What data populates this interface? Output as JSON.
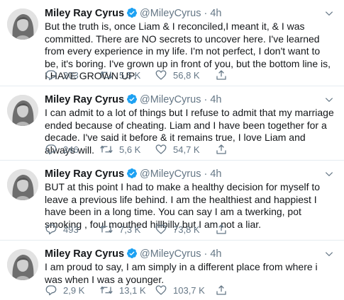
{
  "tweets": [
    {
      "name": "Miley Ray Cyrus",
      "handle": "@MileyCyrus",
      "dot": "·",
      "time": "4h",
      "text": "But the truth is, once Liam & I reconciled,I meant it, & I was committed. There are NO secrets to uncover here. I've learned from every experience in my life. I'm not perfect, I don't want to be, it's boring. I've grown up in front of you, but the bottom line is, I HAVE GROWN UP.",
      "replies": "203",
      "retweets": "5,5 K",
      "likes": "56,8 K"
    },
    {
      "name": "Miley Ray Cyrus",
      "handle": "@MileyCyrus",
      "dot": "·",
      "time": "4h",
      "text": "I can admit to a lot of things but I refuse to admit that my marriage ended because of cheating. Liam and I have been together for a decade. I've said it before & it remains true, I love Liam and always will.",
      "replies": "246",
      "retweets": "5,6 K",
      "likes": "54,7 K"
    },
    {
      "name": "Miley Ray Cyrus",
      "handle": "@MileyCyrus",
      "dot": "·",
      "time": "4h",
      "text": "BUT at this point I had to make a healthy decision for myself to leave a previous life behind. I am the healthiest and happiest I have been in a long time.  You can say I am a twerking, pot smoking , foul mouthed hillbilly but I am not a liar.",
      "replies": "493",
      "retweets": "7,3 K",
      "likes": "73,8 K"
    },
    {
      "name": "Miley Ray Cyrus",
      "handle": "@MileyCyrus",
      "dot": "·",
      "time": "4h",
      "text": "I am proud to say, I am simply in a different place from where i was when I was a younger.",
      "replies": "2,9 K",
      "retweets": "13,1 K",
      "likes": "103,7 K"
    }
  ],
  "icons": {
    "verified": "verified-badge-icon",
    "caret": "chevron-down-icon",
    "reply": "reply-icon",
    "retweet": "retweet-icon",
    "like": "heart-icon",
    "share": "share-icon"
  },
  "colors": {
    "accent": "#1da1f2",
    "secondary_text": "#657786",
    "divider": "#e6ecf0"
  }
}
